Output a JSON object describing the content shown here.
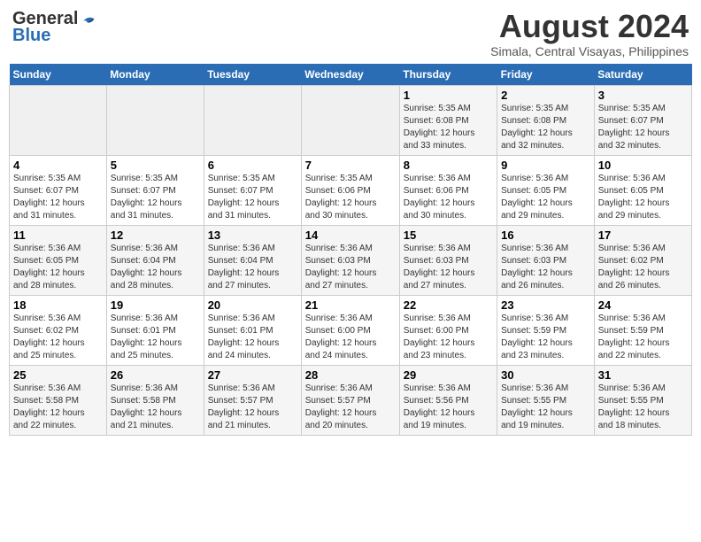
{
  "header": {
    "logo_general": "General",
    "logo_blue": "Blue",
    "title": "August 2024",
    "subtitle": "Simala, Central Visayas, Philippines"
  },
  "weekdays": [
    "Sunday",
    "Monday",
    "Tuesday",
    "Wednesday",
    "Thursday",
    "Friday",
    "Saturday"
  ],
  "weeks": [
    [
      {
        "day": "",
        "info": ""
      },
      {
        "day": "",
        "info": ""
      },
      {
        "day": "",
        "info": ""
      },
      {
        "day": "",
        "info": ""
      },
      {
        "day": "1",
        "info": "Sunrise: 5:35 AM\nSunset: 6:08 PM\nDaylight: 12 hours\nand 33 minutes."
      },
      {
        "day": "2",
        "info": "Sunrise: 5:35 AM\nSunset: 6:08 PM\nDaylight: 12 hours\nand 32 minutes."
      },
      {
        "day": "3",
        "info": "Sunrise: 5:35 AM\nSunset: 6:07 PM\nDaylight: 12 hours\nand 32 minutes."
      }
    ],
    [
      {
        "day": "4",
        "info": "Sunrise: 5:35 AM\nSunset: 6:07 PM\nDaylight: 12 hours\nand 31 minutes."
      },
      {
        "day": "5",
        "info": "Sunrise: 5:35 AM\nSunset: 6:07 PM\nDaylight: 12 hours\nand 31 minutes."
      },
      {
        "day": "6",
        "info": "Sunrise: 5:35 AM\nSunset: 6:07 PM\nDaylight: 12 hours\nand 31 minutes."
      },
      {
        "day": "7",
        "info": "Sunrise: 5:35 AM\nSunset: 6:06 PM\nDaylight: 12 hours\nand 30 minutes."
      },
      {
        "day": "8",
        "info": "Sunrise: 5:36 AM\nSunset: 6:06 PM\nDaylight: 12 hours\nand 30 minutes."
      },
      {
        "day": "9",
        "info": "Sunrise: 5:36 AM\nSunset: 6:05 PM\nDaylight: 12 hours\nand 29 minutes."
      },
      {
        "day": "10",
        "info": "Sunrise: 5:36 AM\nSunset: 6:05 PM\nDaylight: 12 hours\nand 29 minutes."
      }
    ],
    [
      {
        "day": "11",
        "info": "Sunrise: 5:36 AM\nSunset: 6:05 PM\nDaylight: 12 hours\nand 28 minutes."
      },
      {
        "day": "12",
        "info": "Sunrise: 5:36 AM\nSunset: 6:04 PM\nDaylight: 12 hours\nand 28 minutes."
      },
      {
        "day": "13",
        "info": "Sunrise: 5:36 AM\nSunset: 6:04 PM\nDaylight: 12 hours\nand 27 minutes."
      },
      {
        "day": "14",
        "info": "Sunrise: 5:36 AM\nSunset: 6:03 PM\nDaylight: 12 hours\nand 27 minutes."
      },
      {
        "day": "15",
        "info": "Sunrise: 5:36 AM\nSunset: 6:03 PM\nDaylight: 12 hours\nand 27 minutes."
      },
      {
        "day": "16",
        "info": "Sunrise: 5:36 AM\nSunset: 6:03 PM\nDaylight: 12 hours\nand 26 minutes."
      },
      {
        "day": "17",
        "info": "Sunrise: 5:36 AM\nSunset: 6:02 PM\nDaylight: 12 hours\nand 26 minutes."
      }
    ],
    [
      {
        "day": "18",
        "info": "Sunrise: 5:36 AM\nSunset: 6:02 PM\nDaylight: 12 hours\nand 25 minutes."
      },
      {
        "day": "19",
        "info": "Sunrise: 5:36 AM\nSunset: 6:01 PM\nDaylight: 12 hours\nand 25 minutes."
      },
      {
        "day": "20",
        "info": "Sunrise: 5:36 AM\nSunset: 6:01 PM\nDaylight: 12 hours\nand 24 minutes."
      },
      {
        "day": "21",
        "info": "Sunrise: 5:36 AM\nSunset: 6:00 PM\nDaylight: 12 hours\nand 24 minutes."
      },
      {
        "day": "22",
        "info": "Sunrise: 5:36 AM\nSunset: 6:00 PM\nDaylight: 12 hours\nand 23 minutes."
      },
      {
        "day": "23",
        "info": "Sunrise: 5:36 AM\nSunset: 5:59 PM\nDaylight: 12 hours\nand 23 minutes."
      },
      {
        "day": "24",
        "info": "Sunrise: 5:36 AM\nSunset: 5:59 PM\nDaylight: 12 hours\nand 22 minutes."
      }
    ],
    [
      {
        "day": "25",
        "info": "Sunrise: 5:36 AM\nSunset: 5:58 PM\nDaylight: 12 hours\nand 22 minutes."
      },
      {
        "day": "26",
        "info": "Sunrise: 5:36 AM\nSunset: 5:58 PM\nDaylight: 12 hours\nand 21 minutes."
      },
      {
        "day": "27",
        "info": "Sunrise: 5:36 AM\nSunset: 5:57 PM\nDaylight: 12 hours\nand 21 minutes."
      },
      {
        "day": "28",
        "info": "Sunrise: 5:36 AM\nSunset: 5:57 PM\nDaylight: 12 hours\nand 20 minutes."
      },
      {
        "day": "29",
        "info": "Sunrise: 5:36 AM\nSunset: 5:56 PM\nDaylight: 12 hours\nand 19 minutes."
      },
      {
        "day": "30",
        "info": "Sunrise: 5:36 AM\nSunset: 5:55 PM\nDaylight: 12 hours\nand 19 minutes."
      },
      {
        "day": "31",
        "info": "Sunrise: 5:36 AM\nSunset: 5:55 PM\nDaylight: 12 hours\nand 18 minutes."
      }
    ]
  ]
}
